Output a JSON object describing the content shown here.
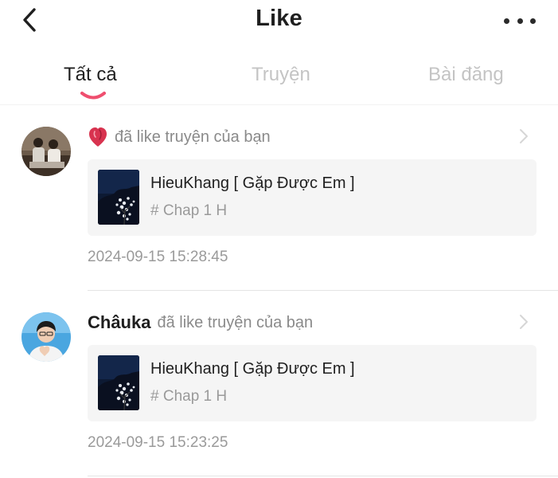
{
  "header": {
    "title": "Like",
    "back_icon": "chevron-left-icon",
    "more_icon": "more-horizontal-icon"
  },
  "tabs": [
    {
      "label": "Tất cả",
      "active": true
    },
    {
      "label": "Truyện",
      "active": false
    },
    {
      "label": "Bài đăng",
      "active": false
    }
  ],
  "colors": {
    "accent": "#ef4f6f",
    "muted_text": "#9a9a9a",
    "card_bg": "#f5f5f5"
  },
  "notifications": [
    {
      "actor": "",
      "icon": "heart-icon",
      "action": "đã like truyện của bạn",
      "story_title": "HieuKhang [ Gặp Được Em ]",
      "chapter": "# Chap 1 H",
      "timestamp": "2024-09-15 15:28:45"
    },
    {
      "actor": "Châuka",
      "action": "đã like truyện của bạn",
      "story_title": "HieuKhang [ Gặp Được Em ]",
      "chapter": "# Chap 1 H",
      "timestamp": "2024-09-15 15:23:25"
    }
  ]
}
